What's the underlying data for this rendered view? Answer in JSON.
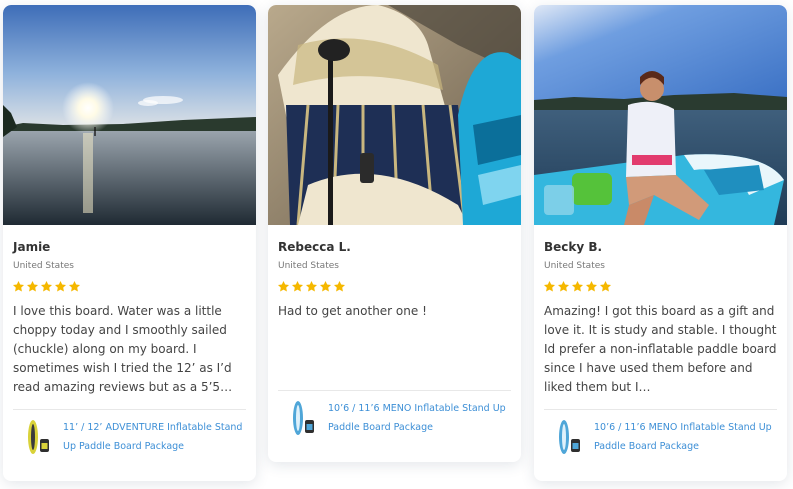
{
  "reviews": [
    {
      "name": "Jamie",
      "country": "United States",
      "rating": 5,
      "text": "I love this board. Water was a little choppy today and I smoothly sailed (chuckle) along on my board. I sometimes wish I tried the 12’ as I’d read amazing reviews but as a 5’5…",
      "photo_icon": "sunset-lake-photo",
      "product": {
        "name": "11’ / 12’ ADVENTURE Inflatable Stand Up Paddle Board Package",
        "thumb_color": "#d9d23a"
      }
    },
    {
      "name": "Rebecca L.",
      "country": "United States",
      "rating": 5,
      "text": "Had to get another one !",
      "photo_icon": "paddle-boards-photo",
      "product": {
        "name": "10’6 / 11’6 MENO Inflatable Stand Up Paddle Board Package",
        "thumb_color": "#4fa6d8"
      }
    },
    {
      "name": "Becky B.",
      "country": "United States",
      "rating": 5,
      "text": "Amazing! I got this board as a gift and love it. It is study and stable. I thought Id prefer a non-inflatable paddle board since I have used them before and liked them but I…",
      "photo_icon": "paddler-on-board-photo",
      "product": {
        "name": "10’6 / 11’6 MENO Inflatable Stand Up Paddle Board Package",
        "thumb_color": "#4fa6d8"
      }
    }
  ],
  "colors": {
    "star": "#f5b800",
    "link": "#3d8fd6",
    "name": "#333333",
    "muted": "#777777"
  }
}
